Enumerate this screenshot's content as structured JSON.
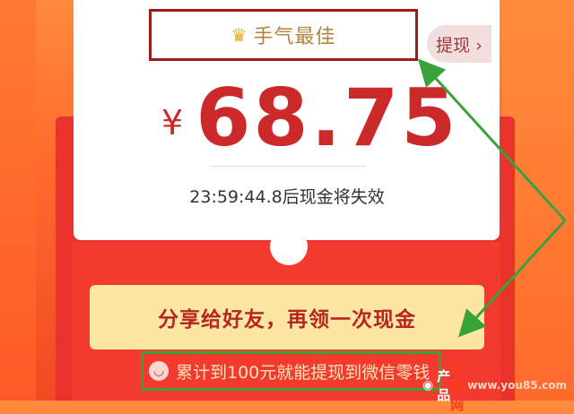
{
  "title": {
    "crown_icon": "crown-icon",
    "text": "手气最佳"
  },
  "withdraw_button": {
    "label": "提现 ›"
  },
  "amount": {
    "currency": "¥",
    "value": "68.75"
  },
  "timer": {
    "text": "23:59:44.8后现金将失效"
  },
  "share_button": {
    "label": "分享给好友，再领一次现金"
  },
  "info": {
    "icon": "wallet-icon",
    "text": "累计到100元就能提现到微信零钱"
  },
  "watermark": {
    "text_prefix": "产品",
    "text_mid": "中城网",
    "site": "www.you85.com"
  },
  "colors": {
    "accent": "#cc2a2a",
    "annotation_green": "#3aa23a",
    "annotation_red": "#9c1b1b"
  }
}
